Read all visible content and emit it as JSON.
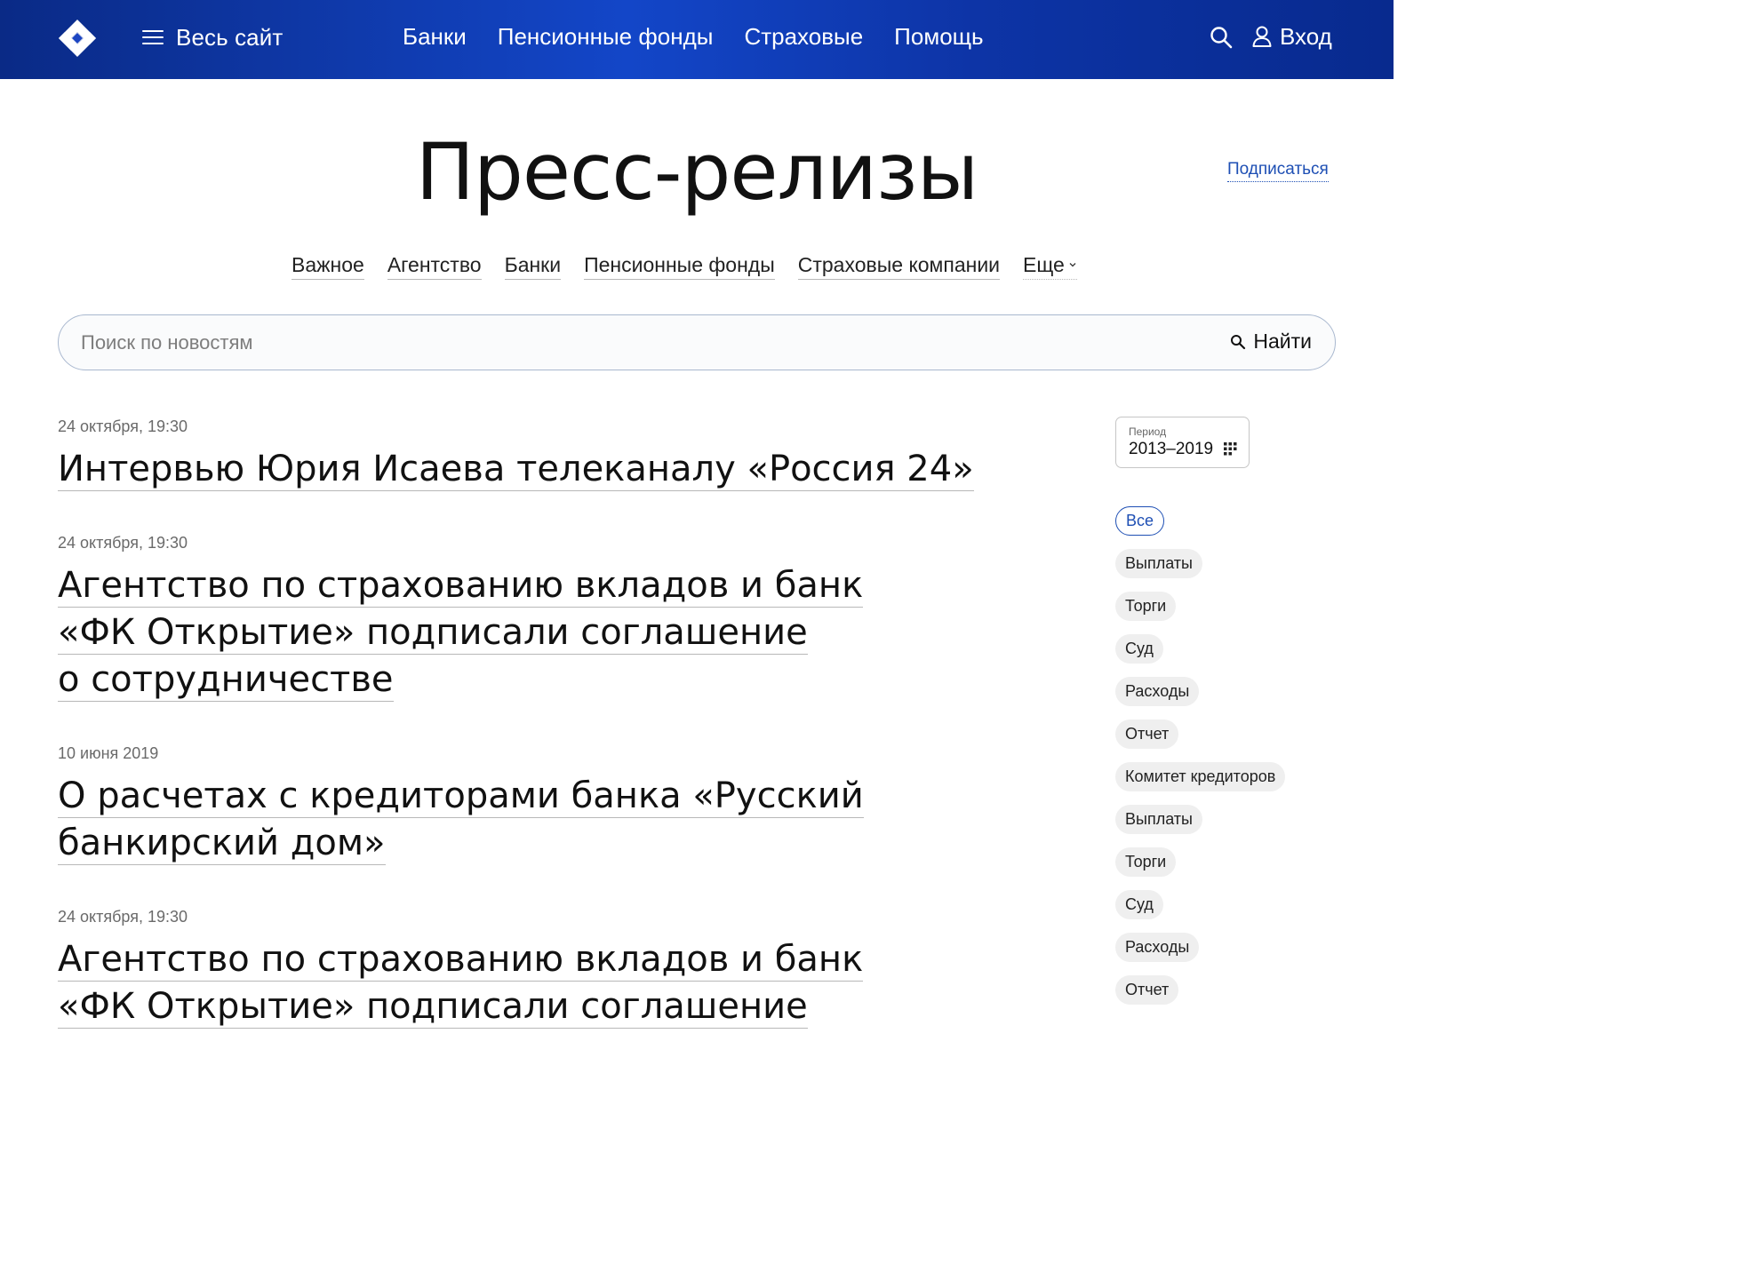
{
  "header": {
    "menu_label": "Весь сайт",
    "nav": [
      "Банки",
      "Пенсионные фонды",
      "Страховые",
      "Помощь"
    ],
    "login_label": "Вход"
  },
  "page": {
    "title": "Пресс-релизы",
    "subscribe_label": "Подписаться"
  },
  "categories": {
    "items": [
      "Важное",
      "Агентство",
      "Банки",
      "Пенсионные фонды",
      "Страховые компании"
    ],
    "more_label": "Еще"
  },
  "search": {
    "placeholder": "Поиск по новостям",
    "value": "",
    "button_label": "Найти"
  },
  "news": [
    {
      "date": "24 октября, 19:30",
      "lines": [
        "Интервью Юрия Исаева телеканалу «Россия 24»"
      ]
    },
    {
      "date": "24 октября, 19:30",
      "lines": [
        "Агентство по страхованию вкладов и банк",
        "«ФК Открытие» подписали соглашение",
        "о сотрудничестве"
      ]
    },
    {
      "date": "10 июня 2019",
      "lines": [
        "О расчетах с кредиторами банка «Русский",
        "банкирский дом»"
      ]
    },
    {
      "date": "24 октября, 19:30",
      "lines": [
        "Агентство по страхованию вкладов и банк",
        "«ФК Открытие» подписали соглашение"
      ]
    }
  ],
  "sidebar": {
    "period_label": "Период",
    "period_value": "2013–2019",
    "tags": [
      "Все",
      "Выплаты",
      "Торги",
      "Суд",
      "Расходы",
      "Отчет",
      "Комитет кредиторов",
      "Выплаты",
      "Торги",
      "Суд",
      "Расходы",
      "Отчет"
    ],
    "active_tag": "Все"
  },
  "colors": {
    "header_gradient_start": "#0a2a86",
    "header_gradient_mid": "#1346c8",
    "accent_link": "#1e4fb4",
    "tag_bg": "#efefef"
  }
}
